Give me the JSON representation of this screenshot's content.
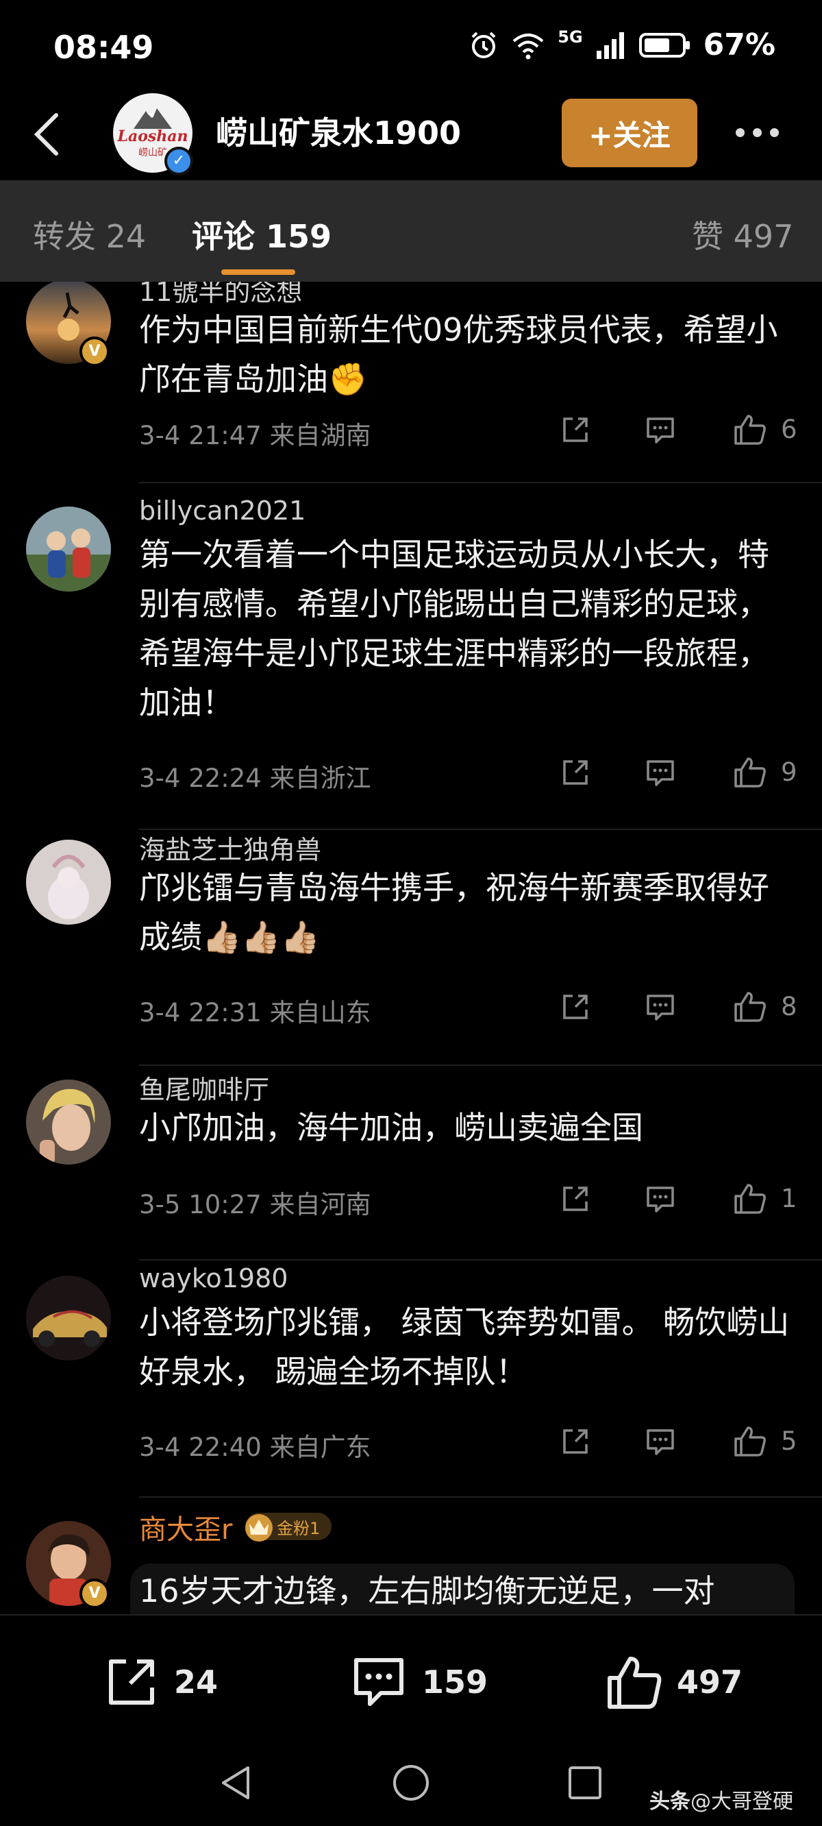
{
  "status_bar": {
    "time": "08:49",
    "network": "5G",
    "battery": "67%",
    "icons": [
      "alarm-icon",
      "wifi-icon",
      "signal-icon",
      "battery-icon"
    ]
  },
  "header": {
    "account_name": "崂山矿泉水1900",
    "avatar_logo_text": "Laoshan",
    "avatar_logo_sub": "崂山矿",
    "follow_label": "+关注",
    "accent_color": "#c9822d"
  },
  "tabs": {
    "repost": "转发 24",
    "comments": "评论 159",
    "likes": "赞 497",
    "active": "comments"
  },
  "comments": [
    {
      "user": "11號半的念想",
      "text": "作为中国目前新生代09优秀球员代表，希望小邝在青岛加油✊",
      "time": "3-4 21:47",
      "location": "来自湖南",
      "likes": "6",
      "verified": true
    },
    {
      "user": "billycan2021",
      "text": "第一次看着一个中国足球运动员从小长大，特别有感情。希望小邝能踢出自己精彩的足球，希望海牛是小邝足球生涯中精彩的一段旅程，加油！",
      "time": "3-4 22:24",
      "location": "来自浙江",
      "likes": "9",
      "verified": false
    },
    {
      "user": "海盐芝士独角兽",
      "text": "邝兆镭与青岛海牛携手，祝海牛新赛季取得好成绩👍🏼👍🏼👍🏼",
      "time": "3-4 22:31",
      "location": "来自山东",
      "likes": "8",
      "verified": false
    },
    {
      "user": "鱼尾咖啡厅",
      "text": "小邝加油，海牛加油，崂山卖遍全国",
      "time": "3-5 10:27",
      "location": "来自河南",
      "likes": "1",
      "verified": false
    },
    {
      "user": "wayko1980",
      "text": "小将登场邝兆镭， 绿茵飞奔势如雷。 畅饮崂山好泉水， 踢遍全场不掉队！",
      "time": "3-4 22:40",
      "location": "来自广东",
      "likes": "5",
      "verified": false
    },
    {
      "user": "商大歪r",
      "fan_badge": "金粉1",
      "text": "16岁天才边锋，左右脚均衡无逆足，一对",
      "verified": true
    }
  ],
  "bottom_bar": {
    "repost_count": "24",
    "comment_count": "159",
    "like_count": "497"
  },
  "watermark": {
    "brand": "头条",
    "handle": "@大哥登硬"
  }
}
